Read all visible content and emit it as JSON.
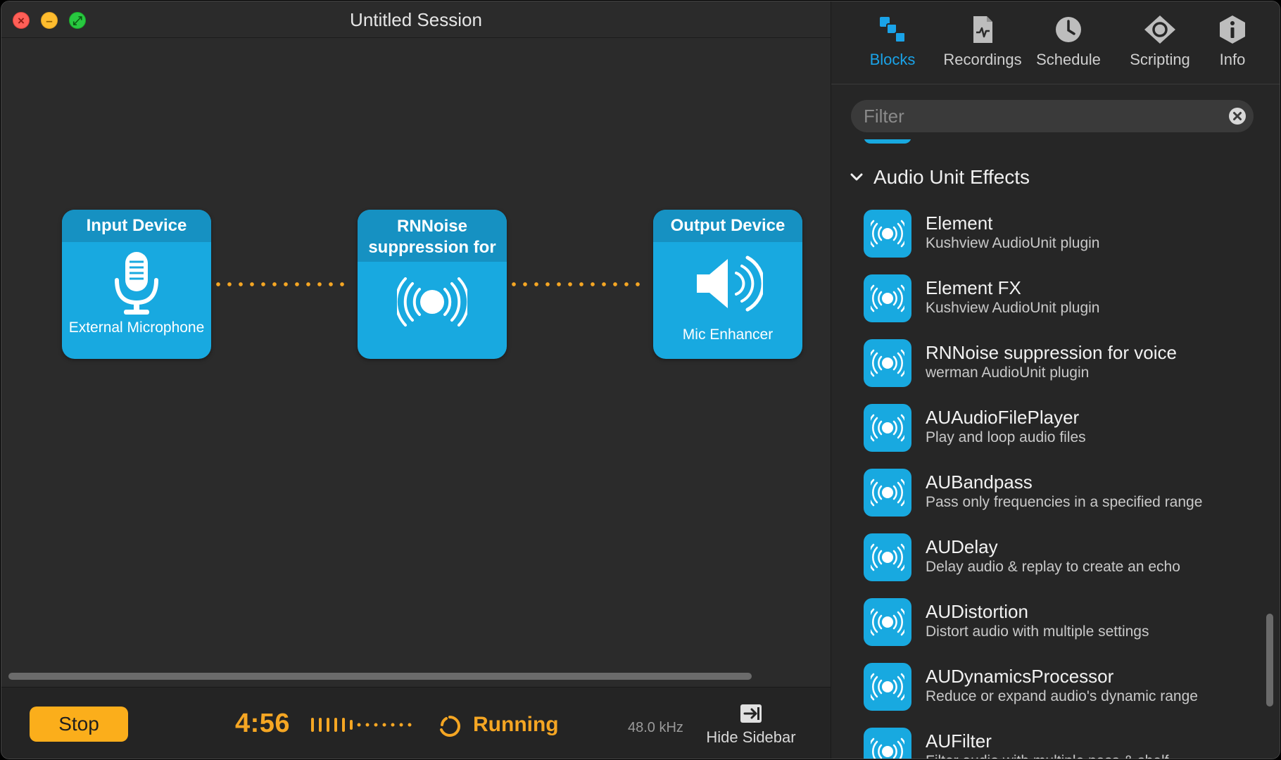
{
  "window": {
    "title": "Untitled Session"
  },
  "blocks": [
    {
      "header": "Input Device",
      "subtitle": "External Microphone",
      "icon": "microphone-icon"
    },
    {
      "header": "RNNoise suppression for",
      "subtitle": "",
      "icon": "audio-unit-icon"
    },
    {
      "header": "Output Device",
      "subtitle": "Mic Enhancer",
      "icon": "speaker-icon"
    }
  ],
  "transport": {
    "stop_label": "Stop",
    "time": "4:56",
    "status": "Running",
    "sample_rate": "48.0 kHz",
    "hide_sidebar_label": "Hide Sidebar"
  },
  "sidebar": {
    "tabs": [
      {
        "label": "Blocks",
        "icon": "blocks-icon",
        "active": true
      },
      {
        "label": "Recordings",
        "icon": "recordings-icon",
        "active": false
      },
      {
        "label": "Schedule",
        "icon": "clock-icon",
        "active": false
      },
      {
        "label": "Scripting",
        "icon": "scripting-icon",
        "active": false
      },
      {
        "label": "Info",
        "icon": "info-icon",
        "active": false
      }
    ],
    "filter_placeholder": "Filter",
    "section_title": "Audio Unit Effects",
    "items": [
      {
        "name": "Element",
        "description": "Kushview AudioUnit plugin"
      },
      {
        "name": "Element FX",
        "description": "Kushview AudioUnit plugin"
      },
      {
        "name": "RNNoise suppression for voice",
        "description": "werman AudioUnit plugin"
      },
      {
        "name": "AUAudioFilePlayer",
        "description": "Play and loop audio files"
      },
      {
        "name": "AUBandpass",
        "description": "Pass only frequencies in a specified range"
      },
      {
        "name": "AUDelay",
        "description": "Delay audio & replay to create an echo"
      },
      {
        "name": "AUDistortion",
        "description": "Distort audio with multiple settings"
      },
      {
        "name": "AUDynamicsProcessor",
        "description": "Reduce or expand audio's dynamic range"
      },
      {
        "name": "AUFilter",
        "description": "Filter audio with multiple pass & shelf"
      }
    ]
  },
  "colors": {
    "accent_blue": "#18a9e0",
    "block_header_blue": "#1691c2",
    "orange": "#f5a623",
    "stop_button": "#fbae1b",
    "active_tab": "#1aa3e8"
  }
}
